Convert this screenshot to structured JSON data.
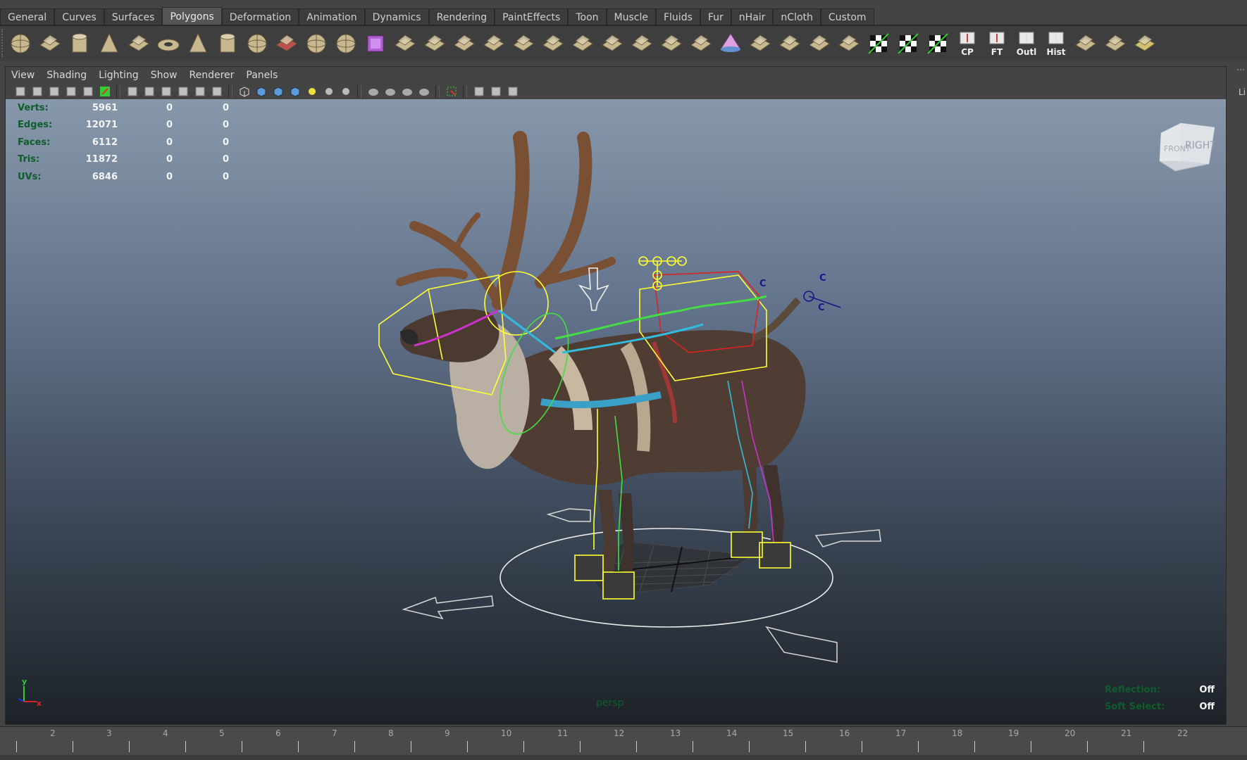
{
  "shelf_tabs": [
    {
      "label": "General"
    },
    {
      "label": "Curves"
    },
    {
      "label": "Surfaces"
    },
    {
      "label": "Polygons",
      "active": true
    },
    {
      "label": "Deformation"
    },
    {
      "label": "Animation"
    },
    {
      "label": "Dynamics"
    },
    {
      "label": "Rendering"
    },
    {
      "label": "PaintEffects"
    },
    {
      "label": "Toon"
    },
    {
      "label": "Muscle"
    },
    {
      "label": "Fluids"
    },
    {
      "label": "Fur"
    },
    {
      "label": "nHair"
    },
    {
      "label": "nCloth"
    },
    {
      "label": "Custom"
    }
  ],
  "shelf_icons": [
    {
      "name": "poly-sphere-icon"
    },
    {
      "name": "poly-cube-icon"
    },
    {
      "name": "poly-cylinder-icon"
    },
    {
      "name": "poly-cone-icon"
    },
    {
      "name": "poly-plane-icon"
    },
    {
      "name": "poly-torus-icon"
    },
    {
      "name": "poly-pyramid-icon"
    },
    {
      "name": "poly-pipe-icon"
    },
    {
      "name": "poly-soccer-icon"
    },
    {
      "name": "combine-icon"
    },
    {
      "name": "separate-icon"
    },
    {
      "name": "smooth-icon"
    },
    {
      "name": "smooth-proxy-icon"
    },
    {
      "name": "mirror-icon"
    },
    {
      "name": "extrude-icon"
    },
    {
      "name": "bridge-icon"
    },
    {
      "name": "append-polygon-icon"
    },
    {
      "name": "split-polygon-icon"
    },
    {
      "name": "insert-edge-loop-icon"
    },
    {
      "name": "merge-icon"
    },
    {
      "name": "offset-edge-loop-icon"
    },
    {
      "name": "slide-edge-icon"
    },
    {
      "name": "wedge-icon"
    },
    {
      "name": "bevel-icon"
    },
    {
      "name": "poke-icon"
    },
    {
      "name": "duplicate-face-icon"
    },
    {
      "name": "sculpt-icon"
    },
    {
      "name": "uv-planar-icon"
    },
    {
      "name": "uv-cylindrical-icon"
    },
    {
      "name": "uv-automatic-icon"
    },
    {
      "name": "uv-editor-icon"
    },
    {
      "name": "checker-icon"
    },
    {
      "name": "center-pivot-icon",
      "label": "CP"
    },
    {
      "name": "freeze-transform-icon",
      "label": "FT"
    },
    {
      "name": "outliner-icon",
      "label": "Outl"
    },
    {
      "name": "history-icon",
      "label": "Hist"
    },
    {
      "name": "transfer-attributes-icon"
    },
    {
      "name": "select-tool-icon"
    },
    {
      "name": "uv-layout-icon"
    }
  ],
  "panel_menu": [
    "View",
    "Shading",
    "Lighting",
    "Show",
    "Renderer",
    "Panels"
  ],
  "panel_toolbar_icons": [
    "select-camera-icon",
    "camera-attributes-icon",
    "bookmarks-icon",
    "image-plane-icon",
    "two-d-pan-icon",
    "grease-pencil-icon",
    "|",
    "grid-icon",
    "film-gate-icon",
    "resolution-gate-icon",
    "gate-mask-icon",
    "field-chart-icon",
    "safe-action-icon",
    "|",
    "wireframe-icon",
    "smooth-shade-icon",
    "wireframe-on-shaded-icon",
    "textured-icon",
    "use-lights-icon",
    "shadows-icon",
    "screen-space-ao-icon",
    "|",
    "motion-blur-icon",
    "multisample-icon",
    "depth-of-field-icon",
    "xray-icon",
    "|",
    "isolate-select-icon",
    "|",
    "xray-joints-icon",
    "xray-active-icon",
    "backface-culling-icon"
  ],
  "hud": {
    "rows": [
      {
        "label": "Verts:",
        "v1": "5961",
        "v2": "0",
        "v3": "0"
      },
      {
        "label": "Edges:",
        "v1": "12071",
        "v2": "0",
        "v3": "0"
      },
      {
        "label": "Faces:",
        "v1": "6112",
        "v2": "0",
        "v3": "0"
      },
      {
        "label": "Tris:",
        "v1": "11872",
        "v2": "0",
        "v3": "0"
      },
      {
        "label": "UVs:",
        "v1": "6846",
        "v2": "0",
        "v3": "0"
      }
    ]
  },
  "viewcube": {
    "right": "RIGHT",
    "front": "FRONT"
  },
  "camera_label": "persp",
  "bottom_hud": [
    {
      "label": "Reflection:",
      "value": "Off"
    },
    {
      "label": "Soft Select:",
      "value": "Off"
    }
  ],
  "control_labels": [
    "C",
    "C",
    "C"
  ],
  "axis": {
    "y": "y",
    "x": "x"
  },
  "right_strip_text": "Li",
  "timeline": {
    "numbers": [
      "2",
      "3",
      "4",
      "5",
      "6",
      "7",
      "8",
      "9",
      "10",
      "11",
      "12",
      "13",
      "14",
      "15",
      "16",
      "17",
      "18",
      "19",
      "20",
      "21",
      "22"
    ]
  },
  "colors": {
    "hud_label": "#0f5c2c",
    "hud_value": "#f4f4f4",
    "rig_yellow": "#ffff33",
    "rig_green": "#44dd44",
    "rig_magenta": "#cc33cc",
    "rig_red": "#dd2222",
    "rig_cyan": "#33bbdd"
  }
}
